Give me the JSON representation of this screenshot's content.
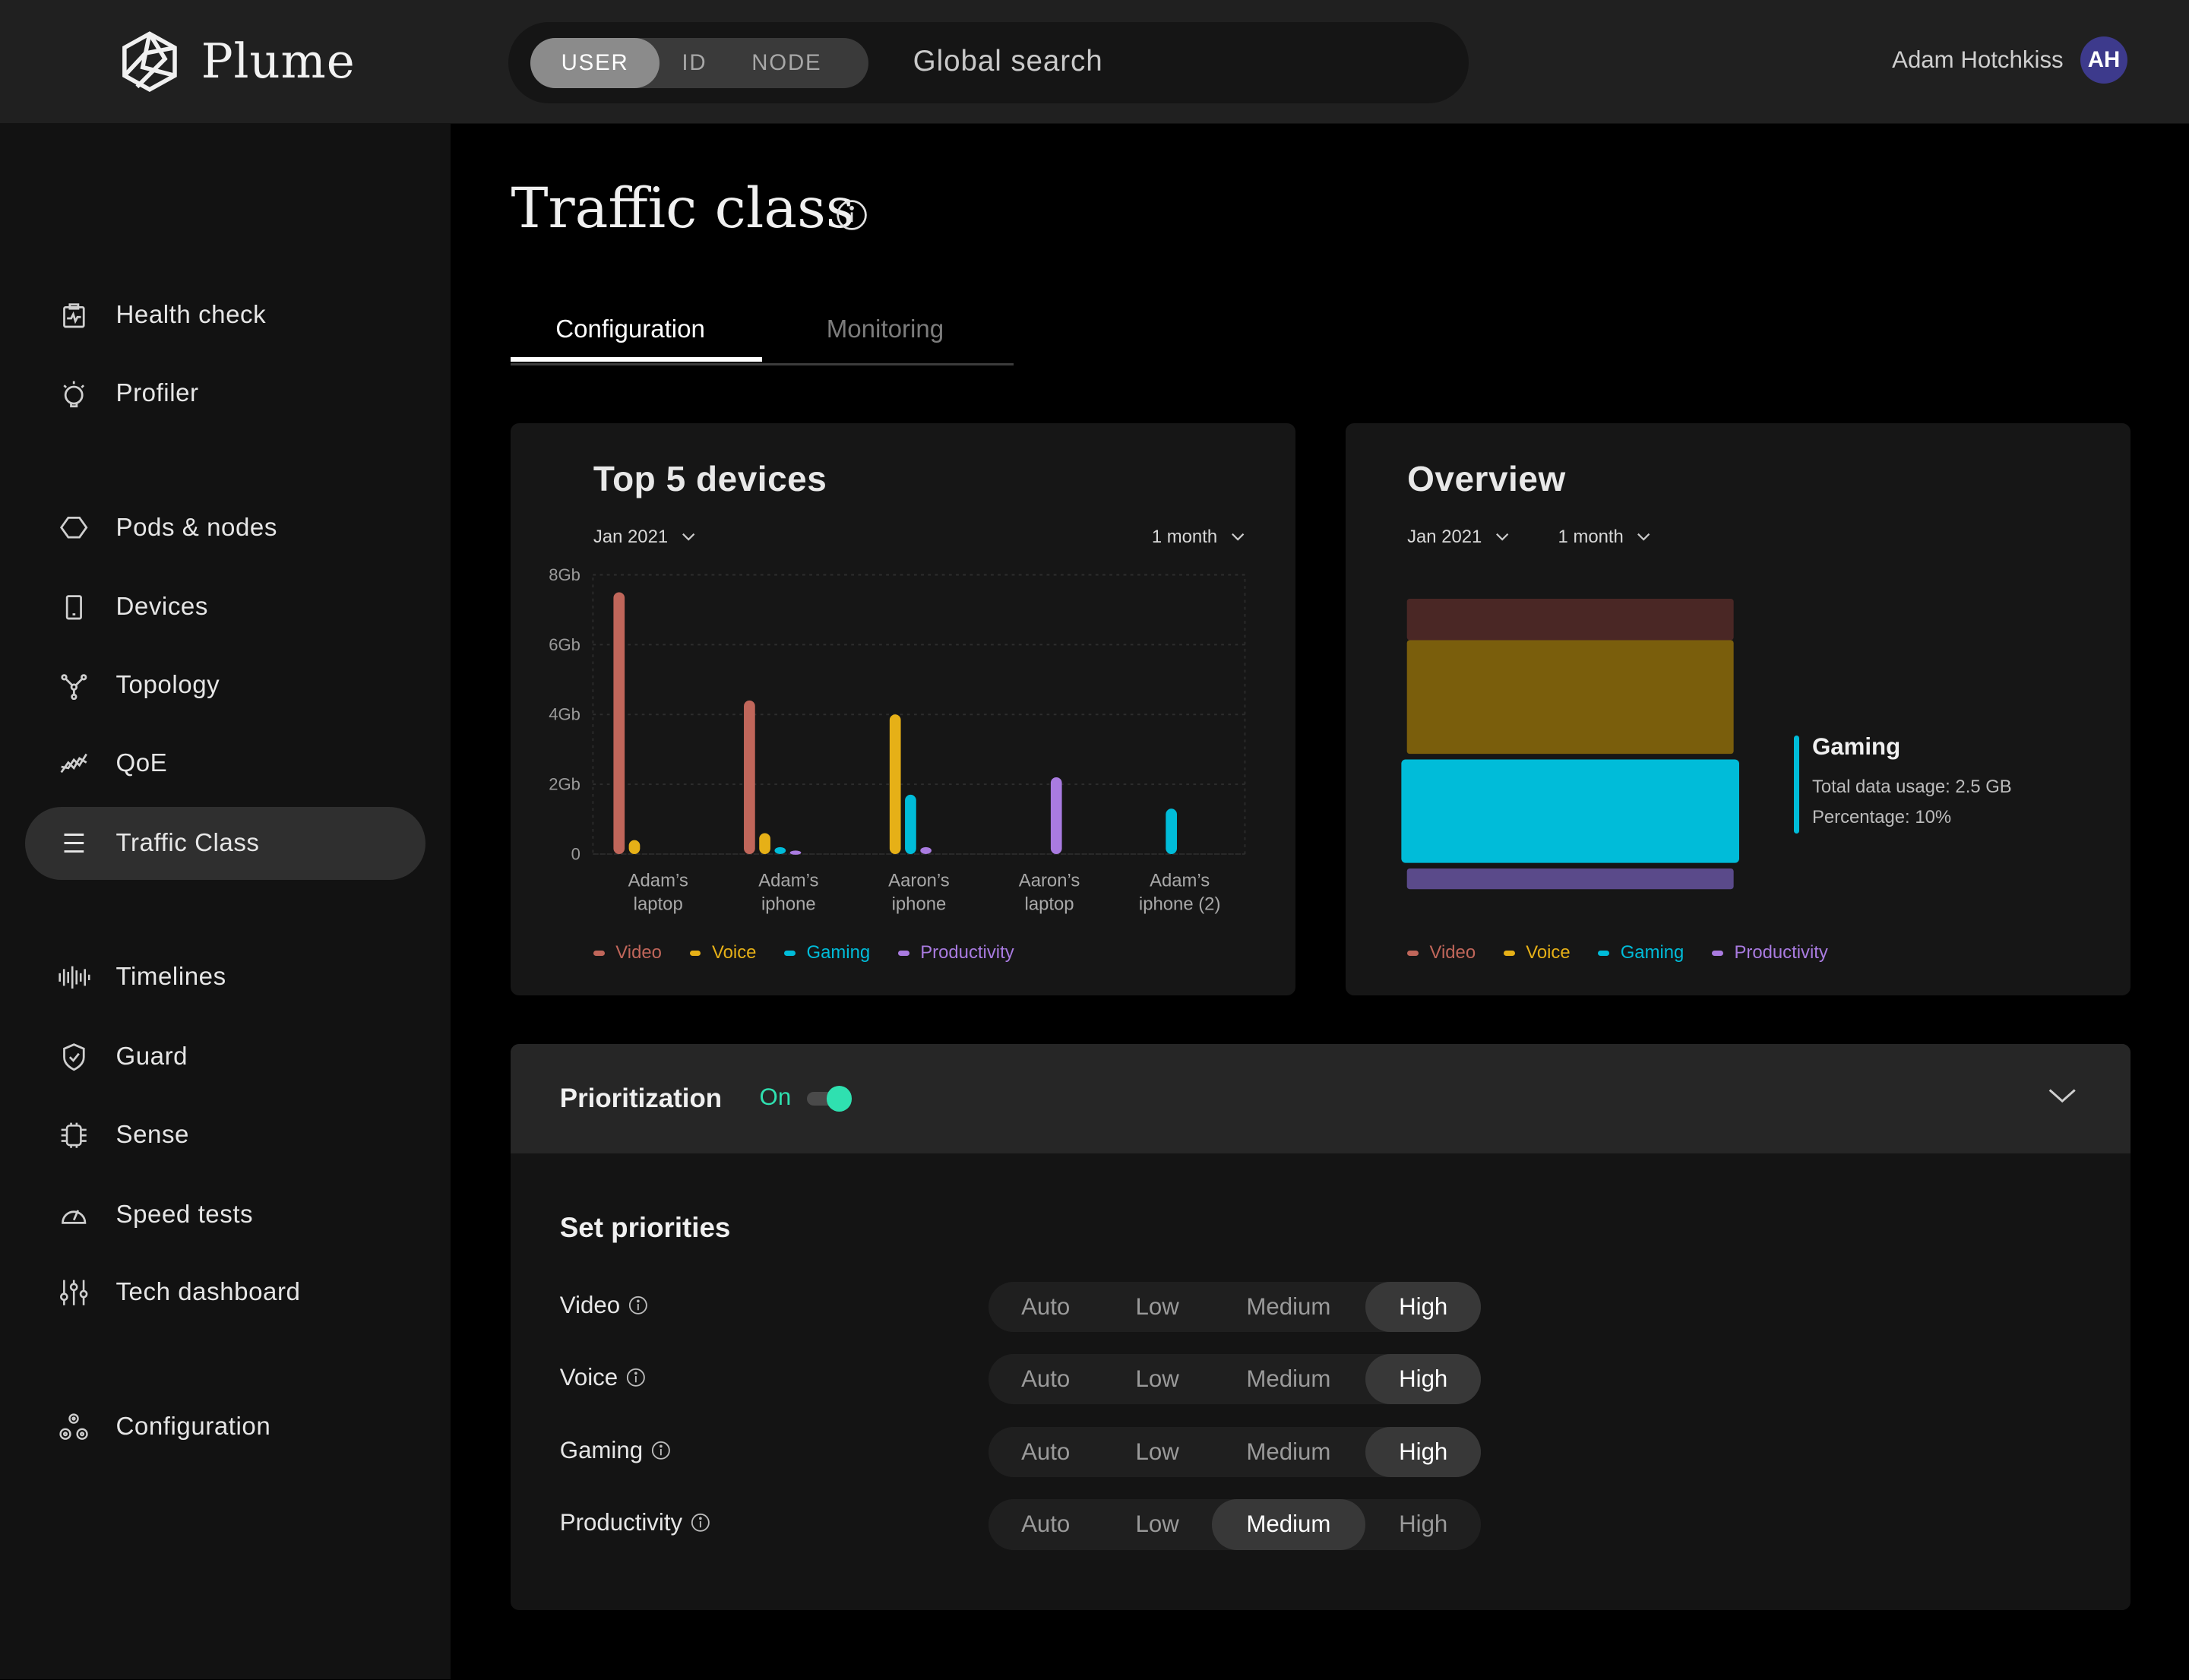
{
  "app": {
    "name": "Plume"
  },
  "search": {
    "modes": [
      "USER",
      "ID",
      "NODE"
    ],
    "active_mode": "USER",
    "placeholder": "Global search"
  },
  "user": {
    "name": "Adam Hotchkiss",
    "initials": "AH"
  },
  "sidebar": {
    "items": [
      {
        "label": "Health check",
        "icon": "clipboard-pulse-icon"
      },
      {
        "label": "Profiler",
        "icon": "lightbulb-icon"
      },
      {
        "label": "Pods & nodes",
        "icon": "hexagon-icon"
      },
      {
        "label": "Devices",
        "icon": "phone-icon"
      },
      {
        "label": "Topology",
        "icon": "topology-icon"
      },
      {
        "label": "QoE",
        "icon": "trend-chart-icon"
      },
      {
        "label": "Traffic Class",
        "icon": "list-icon",
        "active": true
      },
      {
        "label": "Timelines",
        "icon": "waveform-icon"
      },
      {
        "label": "Guard",
        "icon": "shield-check-icon"
      },
      {
        "label": "Sense",
        "icon": "chip-icon"
      },
      {
        "label": "Speed tests",
        "icon": "speedometer-icon"
      },
      {
        "label": "Tech dashboard",
        "icon": "sliders-icon"
      },
      {
        "label": "Configuration",
        "icon": "gears-icon"
      }
    ]
  },
  "page": {
    "title": "Traffic class",
    "tabs": [
      {
        "label": "Configuration",
        "active": true
      },
      {
        "label": "Monitoring",
        "active": false
      }
    ]
  },
  "top_devices": {
    "title": "Top 5 devices",
    "month_filter": "Jan 2021",
    "range_filter": "1 month"
  },
  "overview": {
    "title": "Overview",
    "month_filter": "Jan 2021",
    "range_filter": "1 month",
    "tooltip": {
      "title": "Gaming",
      "usage": "Total data usage: 2.5 GB",
      "percentage": "Percentage: 10%"
    }
  },
  "legend": [
    {
      "name": "Video",
      "color": "#c0665a"
    },
    {
      "name": "Voice",
      "color": "#e6b017"
    },
    {
      "name": "Gaming",
      "color": "#00bcd9"
    },
    {
      "name": "Productivity",
      "color": "#a97be0"
    }
  ],
  "chart_data": [
    {
      "type": "bar",
      "title": "Top 5 devices",
      "categories": [
        "Adam's laptop",
        "Adam's iphone",
        "Aaron's iphone",
        "Aaron's laptop",
        "Adam's iphone (2)"
      ],
      "category_lines": [
        [
          "Adam’s",
          "laptop"
        ],
        [
          "Adam’s",
          "iphone"
        ],
        [
          "Aaron’s",
          "iphone"
        ],
        [
          "Aaron’s",
          "laptop"
        ],
        [
          "Adam’s",
          "iphone (2)"
        ]
      ],
      "series": [
        {
          "name": "Video",
          "values": [
            7.5,
            4.4,
            0,
            0,
            0
          ]
        },
        {
          "name": "Voice",
          "values": [
            0.4,
            0.6,
            4.0,
            0,
            0
          ]
        },
        {
          "name": "Gaming",
          "values": [
            0,
            0.2,
            1.7,
            0,
            1.3
          ]
        },
        {
          "name": "Productivity",
          "values": [
            0,
            0.1,
            0.2,
            2.2,
            0
          ]
        }
      ],
      "ylim": [
        0,
        8
      ],
      "yticks": [
        0,
        2,
        4,
        6,
        8
      ],
      "ytick_labels": [
        "0",
        "2Gb",
        "4Gb",
        "6Gb",
        "8Gb"
      ],
      "grid": true,
      "legend": "bottom"
    },
    {
      "type": "bar",
      "title": "Overview",
      "stacked": true,
      "series": [
        {
          "name": "Video",
          "values": [
            4
          ]
        },
        {
          "name": "Voice",
          "values": [
            11
          ]
        },
        {
          "name": "Gaming",
          "values": [
            10
          ],
          "highlighted": true
        },
        {
          "name": "Productivity",
          "values": [
            2
          ]
        }
      ],
      "legend": "bottom"
    }
  ],
  "prioritization": {
    "title": "Prioritization",
    "state_label": "On",
    "enabled": true,
    "section_title": "Set priorities",
    "levels": [
      "Auto",
      "Low",
      "Medium",
      "High"
    ],
    "rows": [
      {
        "label": "Video",
        "selected": "High"
      },
      {
        "label": "Voice",
        "selected": "High"
      },
      {
        "label": "Gaming",
        "selected": "High"
      },
      {
        "label": "Productivity",
        "selected": "Medium"
      }
    ]
  }
}
